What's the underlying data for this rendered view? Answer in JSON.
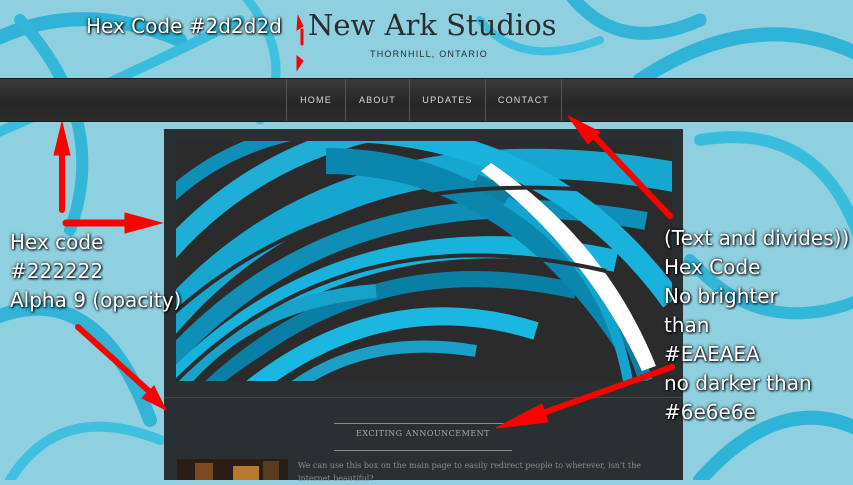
{
  "site": {
    "title": "New Ark Studios",
    "tagline": "THORNHILL, ONTARIO"
  },
  "nav": {
    "items": [
      {
        "label": "HOME"
      },
      {
        "label": "ABOUT"
      },
      {
        "label": "UPDATES"
      },
      {
        "label": "CONTACT"
      }
    ]
  },
  "announcement": {
    "title": "EXCITING ANNOUNCEMENT",
    "body": "We can use this box on the main page to easily redirect people to wherever, isn't the internet beautiful?"
  },
  "annotations": {
    "top": "Hex Code #2d2d2d",
    "left": [
      "Hex code",
      "#222222",
      "Alpha 9 (opacity)"
    ],
    "right": [
      "(Text and divides))",
      "Hex Code",
      "No brighter",
      "than",
      "#EAEAEA",
      "no darker than",
      "#6e6e6e"
    ]
  },
  "colors": {
    "annotation_arrow": "#ff0000",
    "logo_text": "#2d2d2d",
    "panel": "#222222",
    "background": "#8fd0e0"
  }
}
